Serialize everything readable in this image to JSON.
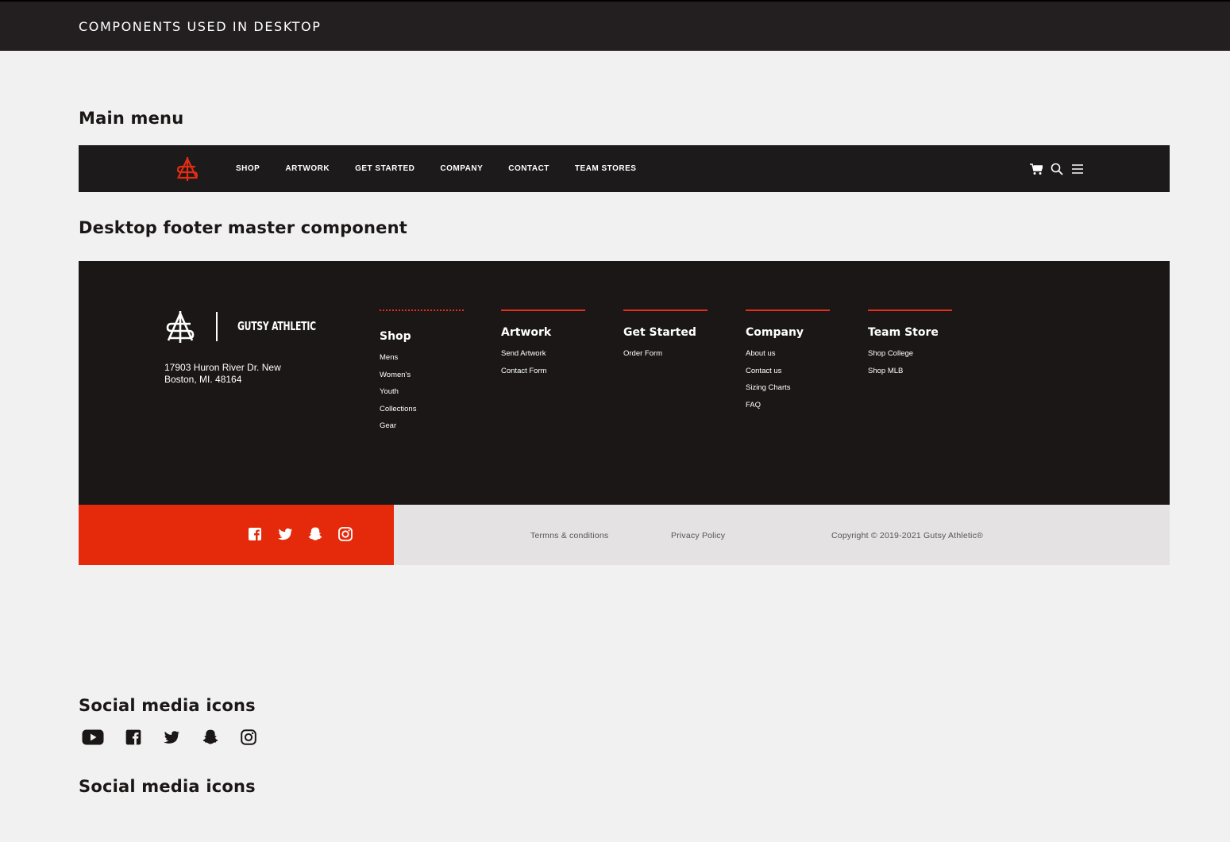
{
  "page": {
    "title": "COMPONENTS USED IN DESKTOP",
    "headings": {
      "main_menu": "Main menu",
      "footer": "Desktop footer master component",
      "social1": "Social media icons",
      "social2": "Social media icons"
    }
  },
  "menu": {
    "items": [
      "SHOP",
      "ARTWORK",
      "GET STARTED",
      "COMPANY",
      "CONTACT",
      "TEAM STORES"
    ],
    "icons": [
      "cart-icon",
      "search-icon",
      "hamburger-menu-icon"
    ]
  },
  "footer": {
    "brand": "GUTSY ATHLETIC",
    "address": "17903 Huron River Dr. New Boston, MI. 48164",
    "columns": [
      {
        "title": "Shop",
        "links": [
          "Mens",
          "Women's",
          "Youth",
          "Collections",
          "Gear"
        ]
      },
      {
        "title": "Artwork",
        "links": [
          "Send Artwork",
          "Contact Form"
        ]
      },
      {
        "title": "Get Started",
        "links": [
          "Order Form"
        ]
      },
      {
        "title": "Company",
        "links": [
          "About us",
          "Contact us",
          "Sizing Charts",
          "FAQ"
        ]
      },
      {
        "title": "Team Store",
        "links": [
          "Shop College",
          "Shop MLB"
        ]
      }
    ],
    "social_icons": [
      "facebook-icon",
      "twitter-icon",
      "snapchat-icon",
      "instagram-icon"
    ],
    "legal": {
      "terms": "Termns & conditions",
      "privacy": "Privacy Policy",
      "copyright": "Copyright © 2019-2021 Gutsy Athletic®"
    }
  },
  "social_icons": [
    "youtube-icon",
    "facebook-icon",
    "twitter-icon",
    "snapchat-icon",
    "instagram-icon"
  ],
  "colors": {
    "accent": "#e52a0b",
    "dark": "#1b1717",
    "light": "#f1f1f1"
  }
}
